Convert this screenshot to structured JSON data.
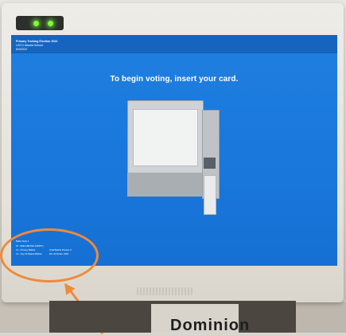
{
  "screen": {
    "header_lines": [
      "Primary Training Election 2022",
      "USCV Atlanta School",
      "6/4/2022"
    ],
    "prompt": "To begin voting, insert your card."
  },
  "footer": {
    "lines_left": [
      "Ballot Style 1",
      "13 - Ballot (BFFEA LRRMT)",
      "14 - Primary Ballots",
      "14 - City Of Atlanta Ballots"
    ],
    "lines_right": [
      "Total Ballots Printed: 0",
      "DS: 20 Rotas: 0001"
    ]
  },
  "hardware": {
    "brand_text": "Dominion"
  },
  "colors": {
    "screen_blue": "#1a78dc",
    "annotation": "#f08a3a",
    "led": "#7cfc3a"
  }
}
